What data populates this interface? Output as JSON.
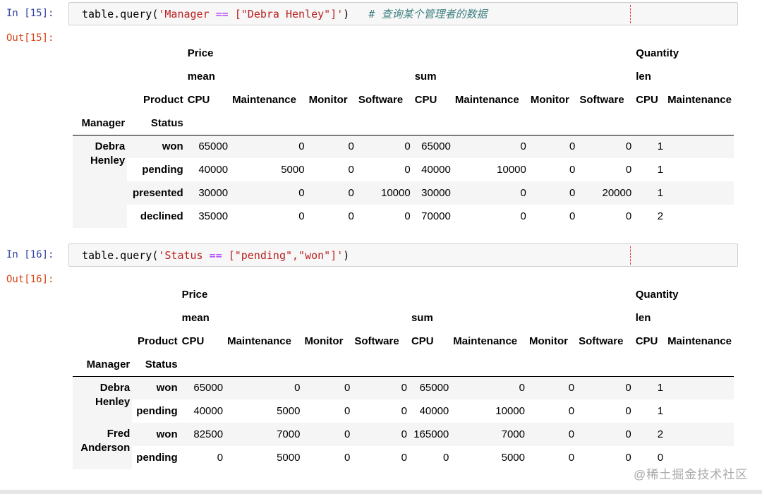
{
  "cells": [
    {
      "in_label": "In [15]:",
      "out_label": "Out[15]:",
      "code": {
        "fn": "table.query(",
        "str_a": "'Manager ",
        "op": "==",
        "str_b": " [\"Debra Henley\"]'",
        "close": ")",
        "comment": "# 查询某个管理者的数据"
      },
      "header": {
        "level0": {
          "price": "Price",
          "quantity": "Quantity"
        },
        "level1": {
          "mean": "mean",
          "sum": "sum",
          "len": "len"
        },
        "level2": {
          "label": "Product",
          "cols": [
            "CPU",
            "Maintenance",
            "Monitor",
            "Software",
            "CPU",
            "Maintenance",
            "Monitor",
            "Software",
            "CPU",
            "Maintenance"
          ]
        },
        "index": {
          "manager": "Manager",
          "status": "Status"
        }
      },
      "rows": [
        {
          "manager": "Debra Henley",
          "status": "won",
          "values": [
            "65000",
            "0",
            "0",
            "0",
            "65000",
            "0",
            "0",
            "0",
            "1",
            ""
          ]
        },
        {
          "manager": "",
          "status": "pending",
          "values": [
            "40000",
            "5000",
            "0",
            "0",
            "40000",
            "10000",
            "0",
            "0",
            "1",
            ""
          ]
        },
        {
          "manager": "",
          "status": "presented",
          "values": [
            "30000",
            "0",
            "0",
            "10000",
            "30000",
            "0",
            "0",
            "20000",
            "1",
            ""
          ]
        },
        {
          "manager": "",
          "status": "declined",
          "values": [
            "35000",
            "0",
            "0",
            "0",
            "70000",
            "0",
            "0",
            "0",
            "2",
            ""
          ]
        }
      ]
    },
    {
      "in_label": "In [16]:",
      "out_label": "Out[16]:",
      "code": {
        "fn": "table.query(",
        "str_a": "'Status ",
        "op": "==",
        "str_b": " [\"pending\",\"won\"]'",
        "close": ")",
        "comment": ""
      },
      "header": {
        "level0": {
          "price": "Price",
          "quantity": "Quantity"
        },
        "level1": {
          "mean": "mean",
          "sum": "sum",
          "len": "len"
        },
        "level2": {
          "label": "Product",
          "cols": [
            "CPU",
            "Maintenance",
            "Monitor",
            "Software",
            "CPU",
            "Maintenance",
            "Monitor",
            "Software",
            "CPU",
            "Maintenance"
          ]
        },
        "index": {
          "manager": "Manager",
          "status": "Status"
        }
      },
      "rows": [
        {
          "manager": "Debra Henley",
          "status": "won",
          "values": [
            "65000",
            "0",
            "0",
            "0",
            "65000",
            "0",
            "0",
            "0",
            "1",
            ""
          ]
        },
        {
          "manager": "",
          "status": "pending",
          "values": [
            "40000",
            "5000",
            "0",
            "0",
            "40000",
            "10000",
            "0",
            "0",
            "1",
            ""
          ]
        },
        {
          "manager": "Fred Anderson",
          "status": "won",
          "values": [
            "82500",
            "7000",
            "0",
            "0",
            "165000",
            "7000",
            "0",
            "0",
            "2",
            ""
          ]
        },
        {
          "manager": "",
          "status": "pending",
          "values": [
            "0",
            "5000",
            "0",
            "0",
            "0",
            "5000",
            "0",
            "0",
            "0",
            ""
          ]
        }
      ]
    }
  ],
  "watermark": "@稀土掘金技术社区"
}
